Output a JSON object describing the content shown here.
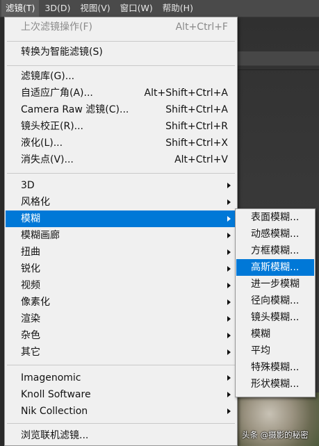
{
  "menubar": {
    "items": [
      {
        "label": "滤镜(T)",
        "active": true
      },
      {
        "label": "3D(D)",
        "active": false
      },
      {
        "label": "视图(V)",
        "active": false
      },
      {
        "label": "窗口(W)",
        "active": false
      },
      {
        "label": "帮助(H)",
        "active": false
      }
    ]
  },
  "filter_menu": {
    "last_filter": {
      "label": "上次滤镜操作(F)",
      "shortcut": "Alt+Ctrl+F"
    },
    "smart_filters": {
      "label": "转换为智能滤镜(S)"
    },
    "filter_gallery": {
      "label": "滤镜库(G)..."
    },
    "adaptive_wide_angle": {
      "label": "自适应广角(A)...",
      "shortcut": "Alt+Shift+Ctrl+A"
    },
    "camera_raw": {
      "label": "Camera Raw 滤镜(C)...",
      "shortcut": "Shift+Ctrl+A"
    },
    "lens_correction": {
      "label": "镜头校正(R)...",
      "shortcut": "Shift+Ctrl+R"
    },
    "liquify": {
      "label": "液化(L)...",
      "shortcut": "Shift+Ctrl+X"
    },
    "vanishing_point": {
      "label": "消失点(V)...",
      "shortcut": "Alt+Ctrl+V"
    },
    "categories": [
      "3D",
      "风格化",
      "模糊",
      "模糊画廊",
      "扭曲",
      "锐化",
      "视频",
      "像素化",
      "渲染",
      "杂色",
      "其它"
    ],
    "plugins": [
      "Imagenomic",
      "Knoll Software",
      "Nik Collection"
    ],
    "browse_online": {
      "label": "浏览联机滤镜..."
    }
  },
  "blur_submenu": {
    "items": [
      "表面模糊...",
      "动感模糊...",
      "方框模糊...",
      "高斯模糊...",
      "进一步模糊",
      "径向模糊...",
      "镜头模糊...",
      "模糊",
      "平均",
      "特殊模糊...",
      "形状模糊..."
    ]
  },
  "watermark": "头条 @摄影的秘密",
  "colors": {
    "highlight": "#0078d7",
    "menu_bg": "#f0f0f0",
    "menubar_bg": "#4a4a4a"
  }
}
